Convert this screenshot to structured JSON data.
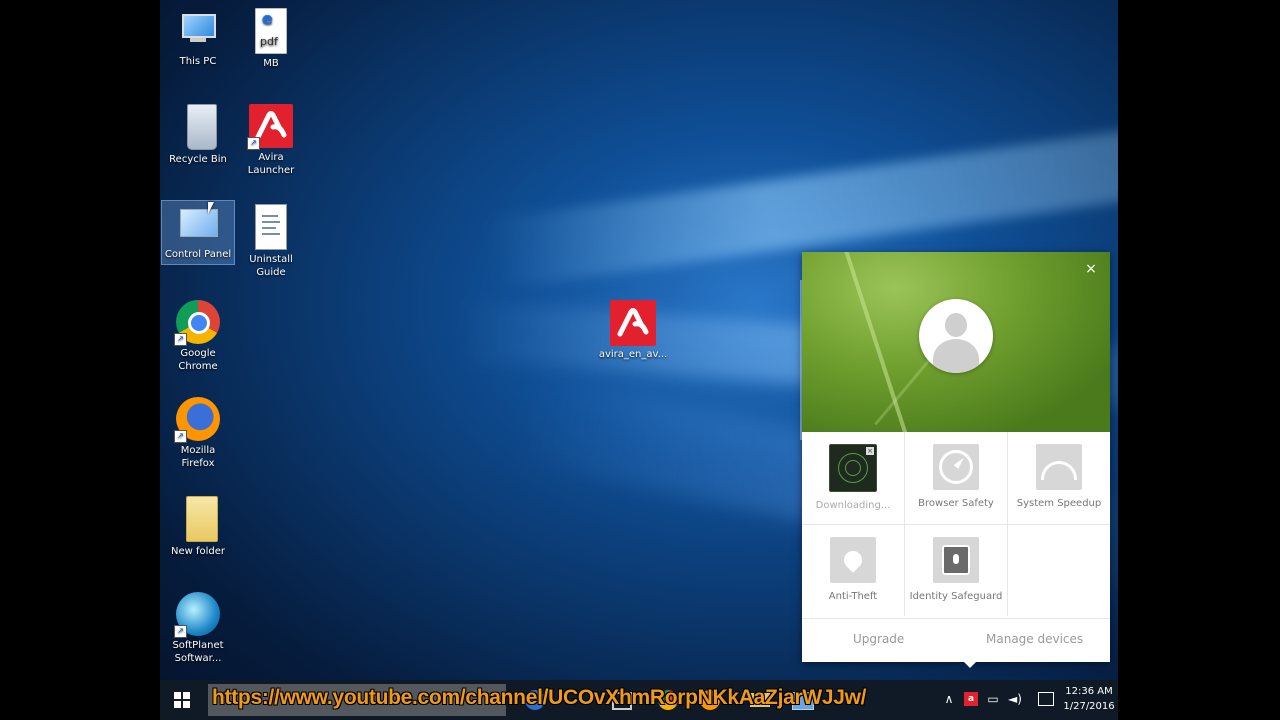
{
  "desktop_icons": {
    "this_pc": "This PC",
    "mb": "MB",
    "pdf_tag": "pdf",
    "recycle_bin": "Recycle Bin",
    "avira_launcher_1": "Avira",
    "avira_launcher_2": "Launcher",
    "control_panel": "Control Panel",
    "uninstall_1": "Uninstall",
    "uninstall_2": "Guide",
    "chrome_1": "Google",
    "chrome_2": "Chrome",
    "firefox_1": "Mozilla",
    "firefox_2": "Firefox",
    "new_folder": "New folder",
    "softplanet_1": "SoftPlanet",
    "softplanet_2": "Softwar...",
    "avira_installer": "avira_en_av..."
  },
  "avira_popup": {
    "close": "×",
    "tiles": [
      {
        "label": "Downloading..."
      },
      {
        "label": "Browser Safety"
      },
      {
        "label": "System Speedup"
      },
      {
        "label": "Anti-Theft"
      },
      {
        "label": "Identity Safeguard"
      }
    ],
    "footer": {
      "upgrade": "Upgrade",
      "manage": "Manage devices"
    }
  },
  "overlay": {
    "url": "https://www.youtube.com/channel/UCOvXhmRorpNKkAaZjarWJJw/"
  },
  "taskbar": {
    "time": "12:36 AM",
    "date": "1/27/2016"
  },
  "colors": {
    "avira_red": "#e3202e",
    "taskbar": "#0f1a26",
    "url_orange": "#f29a18",
    "leaf_green": "#6f9f2e"
  }
}
